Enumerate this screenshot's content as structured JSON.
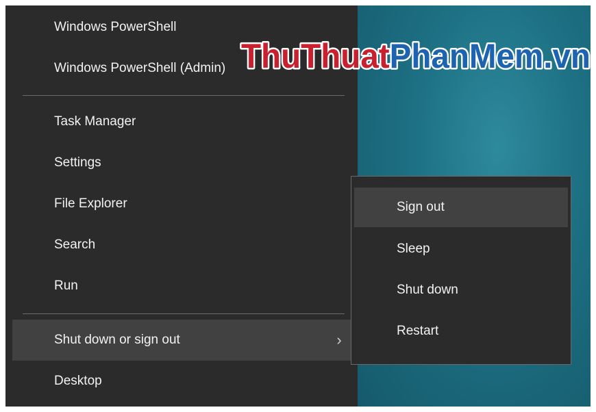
{
  "menu": {
    "items": [
      {
        "label": "Windows PowerShell"
      },
      {
        "label": "Windows PowerShell (Admin)"
      },
      {
        "label": "Task Manager"
      },
      {
        "label": "Settings"
      },
      {
        "label": "File Explorer"
      },
      {
        "label": "Search"
      },
      {
        "label": "Run"
      },
      {
        "label": "Shut down or sign out"
      },
      {
        "label": "Desktop"
      }
    ]
  },
  "submenu": {
    "items": [
      {
        "label": "Sign out"
      },
      {
        "label": "Sleep"
      },
      {
        "label": "Shut down"
      },
      {
        "label": "Restart"
      }
    ]
  },
  "watermark": {
    "text": "ThuThuatPhanMem.vn"
  },
  "colors": {
    "menu_bg": "#2b2b2b",
    "hover_bg": "#414141",
    "desktop": "#1d6f82",
    "watermark_red": "#c8202e",
    "watermark_blue": "#1e63b0"
  }
}
